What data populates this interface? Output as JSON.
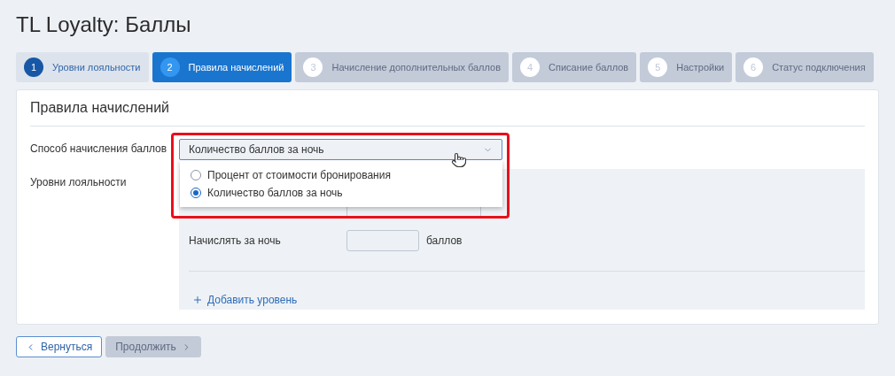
{
  "title": "TL Loyalty: Баллы",
  "steps": [
    {
      "number": "1",
      "label": "Уровни лояльности",
      "selected": false,
      "enabled": true
    },
    {
      "number": "2",
      "label": "Правила начислений",
      "selected": true,
      "enabled": true
    },
    {
      "number": "3",
      "label": "Начисление дополнительных баллов",
      "selected": false,
      "enabled": false
    },
    {
      "number": "4",
      "label": "Списание баллов",
      "selected": false,
      "enabled": false
    },
    {
      "number": "5",
      "label": "Настройки",
      "selected": false,
      "enabled": false
    },
    {
      "number": "6",
      "label": "Статус подключения",
      "selected": false,
      "enabled": false
    }
  ],
  "card": {
    "title": "Правила начислений",
    "method": {
      "label": "Способ начисления баллов",
      "value": "Количество баллов за ночь",
      "expanded": true,
      "options": [
        {
          "label": "Процент от стоимости бронирования",
          "selected": false
        },
        {
          "label": "Количество баллов за ночь",
          "selected": true
        }
      ]
    },
    "levels": {
      "label": "Уровни лояльности",
      "per_night_label": "Начислять за ночь",
      "unit": "баллов",
      "add_link": "Добавить уровень"
    }
  },
  "buttons": [
    {
      "label": "Вернуться",
      "disabled": false
    },
    {
      "label": "Продолжить",
      "disabled": true
    }
  ]
}
